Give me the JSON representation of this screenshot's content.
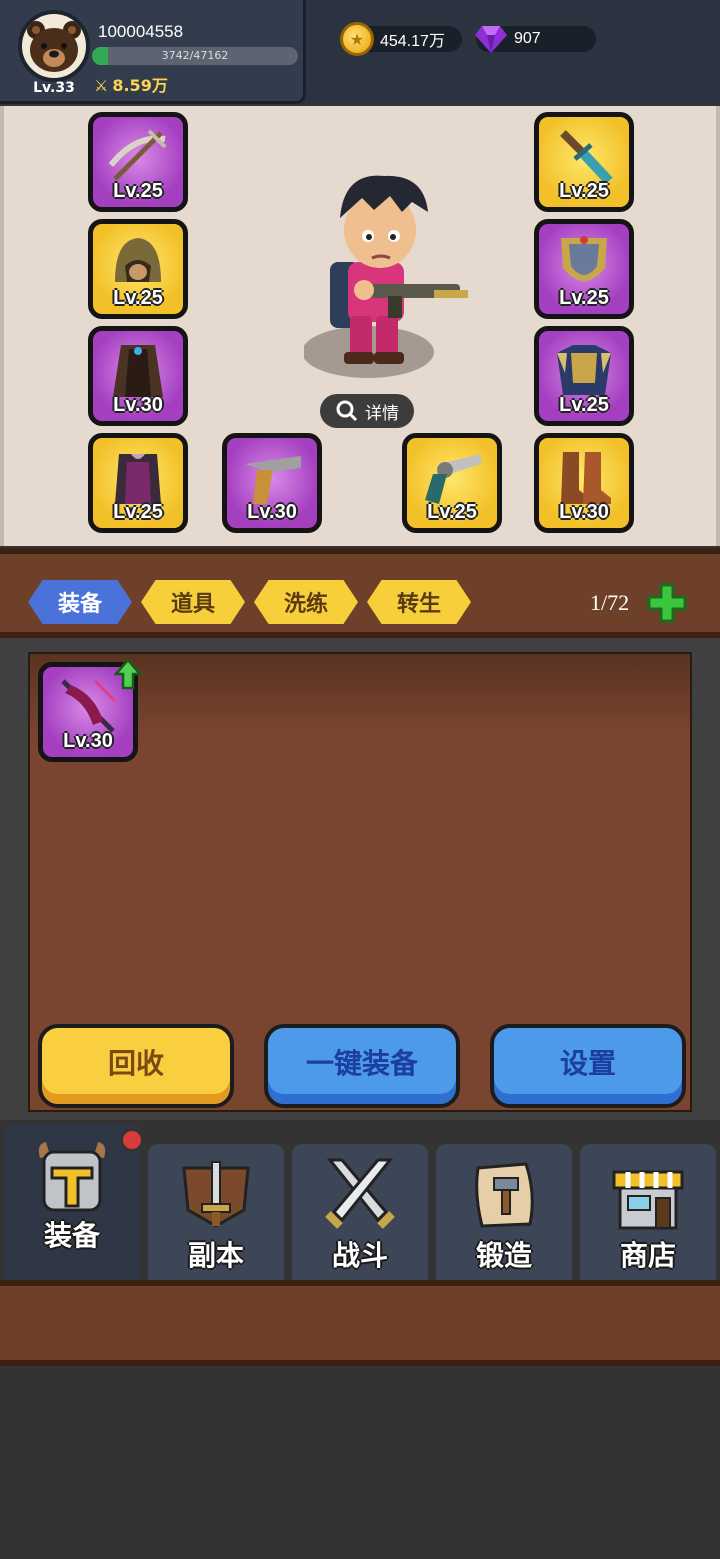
{
  "header": {
    "player_id": "100004558",
    "level": "Lv.33",
    "xp_text": "3742/47162",
    "xp_fraction": 0.079,
    "power": "8.59万",
    "gold": "454.17万",
    "gems": "907"
  },
  "character": {
    "detail_label": "详情",
    "slots": [
      {
        "name": "slot-left-1",
        "level": "Lv.25",
        "rarity": "purple",
        "icon": "crossbow-icon"
      },
      {
        "name": "slot-left-2",
        "level": "Lv.25",
        "rarity": "gold",
        "icon": "helmet-icon"
      },
      {
        "name": "slot-left-3",
        "level": "Lv.30",
        "rarity": "purple",
        "icon": "cloak-icon"
      },
      {
        "name": "slot-left-4",
        "level": "Lv.25",
        "rarity": "gold",
        "icon": "armor-icon"
      },
      {
        "name": "slot-right-1",
        "level": "Lv.25",
        "rarity": "gold",
        "icon": "dagger-icon"
      },
      {
        "name": "slot-right-2",
        "level": "Lv.25",
        "rarity": "purple",
        "icon": "shield-icon"
      },
      {
        "name": "slot-right-3",
        "level": "Lv.25",
        "rarity": "purple",
        "icon": "chestplate-icon"
      },
      {
        "name": "slot-right-4",
        "level": "Lv.30",
        "rarity": "gold",
        "icon": "boots-icon"
      },
      {
        "name": "slot-bottom-1",
        "level": "Lv.30",
        "rarity": "purple",
        "icon": "pistol-icon"
      },
      {
        "name": "slot-bottom-2",
        "level": "Lv.25",
        "rarity": "gold",
        "icon": "revolver-icon"
      }
    ]
  },
  "tabs": {
    "items": [
      "装备",
      "道具",
      "洗练",
      "转生"
    ],
    "active": "装备",
    "capacity": "1/72"
  },
  "inventory": {
    "items": [
      {
        "level": "Lv.30",
        "rarity": "purple",
        "icon": "spear-icon",
        "upgrade": true
      }
    ]
  },
  "actions": {
    "recycle": "回收",
    "auto_equip": "一键装备",
    "settings": "设置"
  },
  "nav": {
    "items": [
      {
        "label": "装备",
        "icon": "helmet-nav-icon",
        "active": true,
        "badge": true
      },
      {
        "label": "副本",
        "icon": "sword-shield-icon",
        "active": false
      },
      {
        "label": "战斗",
        "icon": "crossed-swords-icon",
        "active": false
      },
      {
        "label": "锻造",
        "icon": "scroll-hammer-icon",
        "active": false
      },
      {
        "label": "商店",
        "icon": "shop-icon",
        "active": false
      }
    ]
  },
  "colors": {
    "purple_rarity": "#b04fd0",
    "gold_rarity": "#f2c12a",
    "active_tab": "#3e86ec",
    "inactive_tab": "#f6cf3a",
    "wood": "#6e4029"
  }
}
